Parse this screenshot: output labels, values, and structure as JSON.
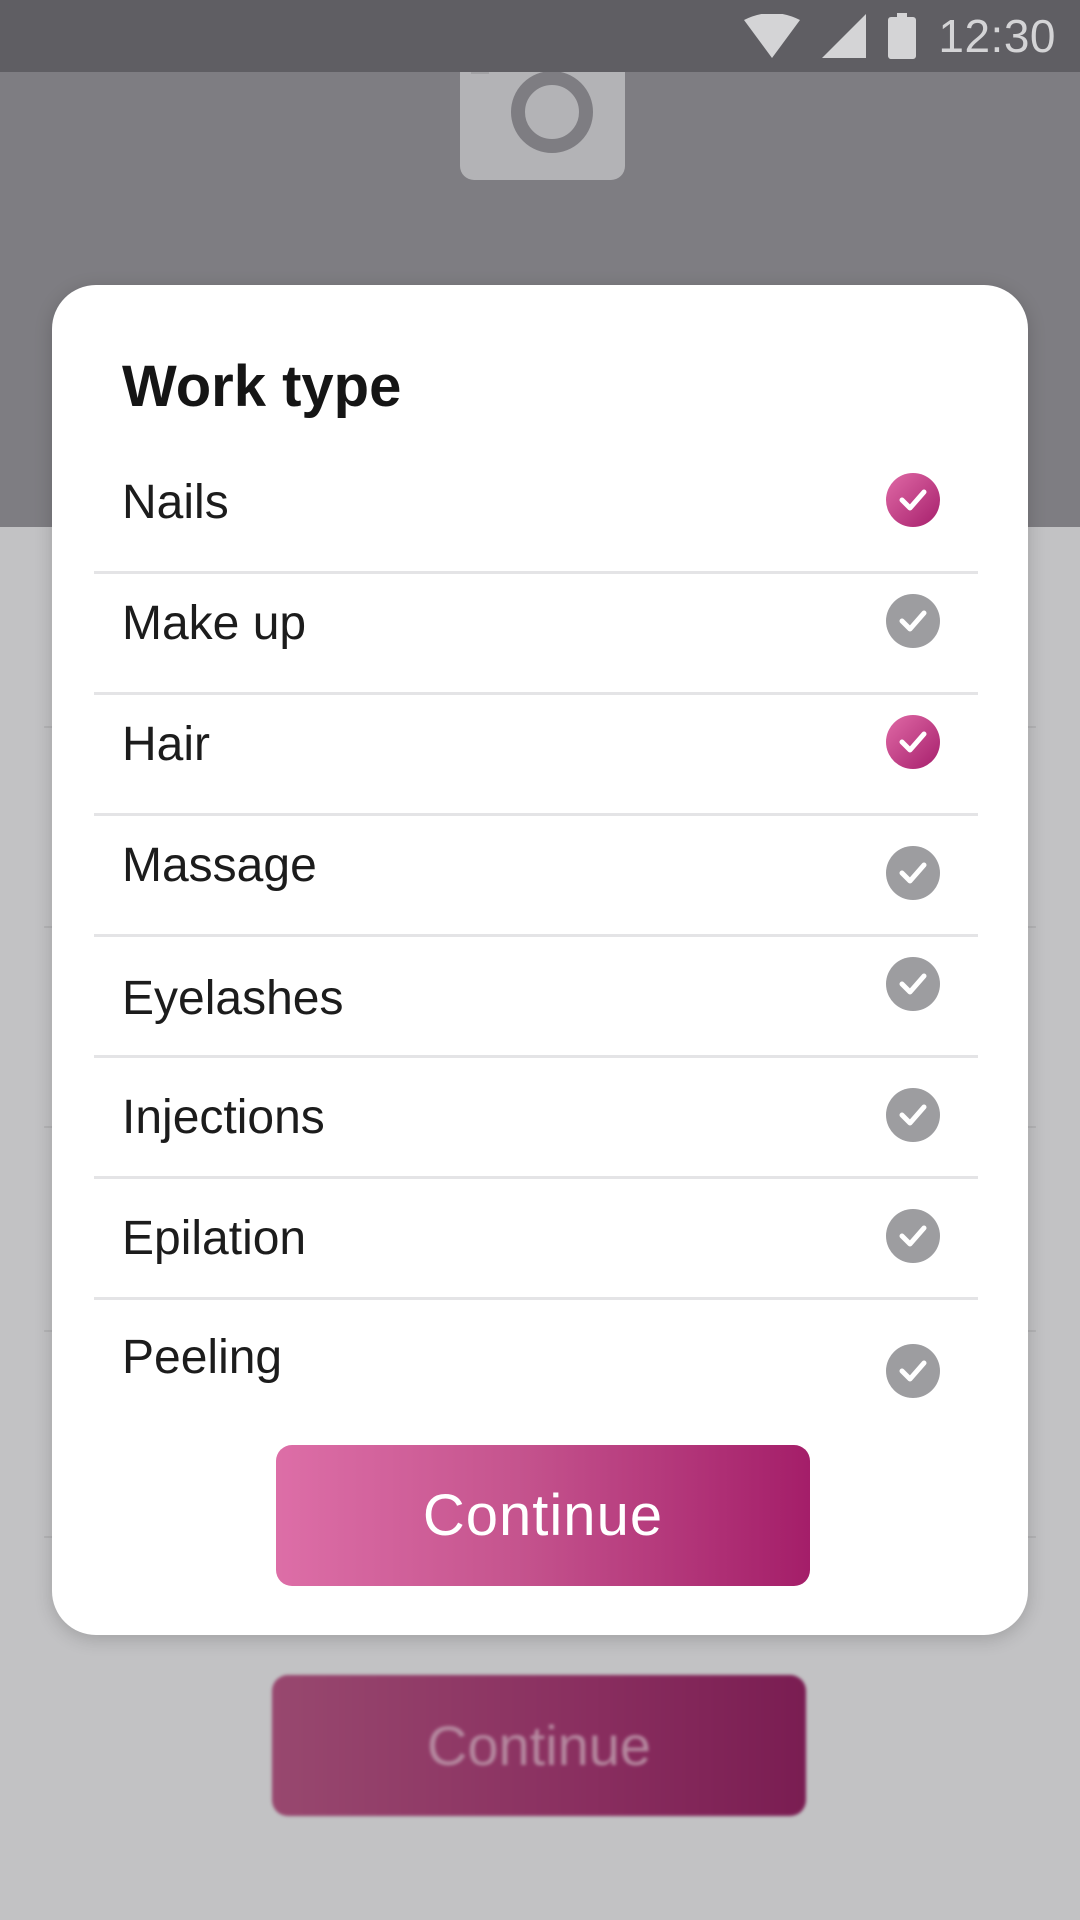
{
  "status_bar": {
    "time": "12:30"
  },
  "background": {
    "continue_label": "Continue"
  },
  "dialog": {
    "title": "Work type",
    "options": [
      {
        "label": "Nails",
        "checked": true
      },
      {
        "label": "Make up",
        "checked": false
      },
      {
        "label": "Hair",
        "checked": true
      },
      {
        "label": "Massage",
        "checked": false
      },
      {
        "label": "Eyelashes",
        "checked": false
      },
      {
        "label": "Injections",
        "checked": false
      },
      {
        "label": "Epilation",
        "checked": false
      },
      {
        "label": "Peeling",
        "checked": false
      }
    ],
    "continue_label": "Continue"
  },
  "colors": {
    "accent_start": "#dd6ea7",
    "accent_end": "#a41e69",
    "unchecked": "#9d9da0"
  }
}
